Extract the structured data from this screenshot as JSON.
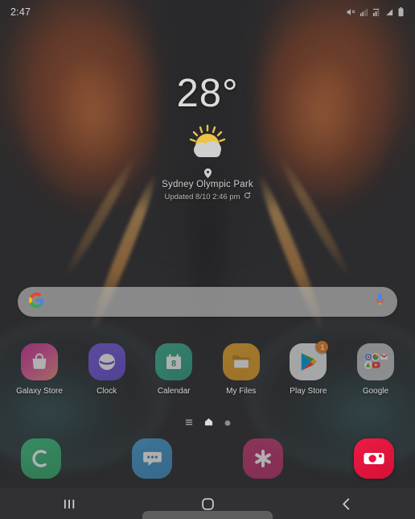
{
  "status_bar": {
    "time": "2:47",
    "icons": [
      "mute-icon",
      "signal-bars-icon",
      "signal-bars-alt-icon",
      "wifi-signal-icon",
      "battery-icon"
    ]
  },
  "weather_widget": {
    "temperature": "28°",
    "condition_icon": "partly-cloudy-icon",
    "location": "Sydney Olympic Park",
    "updated": "Updated 8/10 2:46 pm",
    "refresh_icon": "refresh-icon",
    "location_pin_icon": "location-pin-icon"
  },
  "search": {
    "google_icon": "google-g-icon",
    "mic_icon": "microphone-icon",
    "placeholder": ""
  },
  "apps": [
    {
      "label": "Galaxy Store",
      "icon": "galaxy-store-icon",
      "badge": ""
    },
    {
      "label": "Clock",
      "icon": "clock-icon",
      "badge": ""
    },
    {
      "label": "Calendar",
      "icon": "calendar-icon",
      "badge": "",
      "day": "8"
    },
    {
      "label": "My Files",
      "icon": "my-files-icon",
      "badge": ""
    },
    {
      "label": "Play Store",
      "icon": "play-store-icon",
      "badge": "1"
    },
    {
      "label": "Google",
      "icon": "google-folder-icon",
      "badge": ""
    }
  ],
  "page_indicator": {
    "items": [
      "apps-list-icon",
      "home-page-icon",
      "page-dot-icon"
    ],
    "active_index": 1
  },
  "dock": [
    {
      "label": "Phone",
      "icon": "phone-icon"
    },
    {
      "label": "Messages",
      "icon": "messages-icon"
    },
    {
      "label": "Gallery",
      "icon": "gallery-icon"
    },
    {
      "label": "Camera",
      "icon": "camera-icon"
    }
  ],
  "navigation_bar": [
    {
      "label": "Recents",
      "icon": "recents-icon"
    },
    {
      "label": "Home",
      "icon": "home-icon"
    },
    {
      "label": "Back",
      "icon": "back-icon"
    }
  ],
  "colors": {
    "background": "#323234",
    "accent_orange": "#c56838",
    "camera_red": "#e8123c",
    "badge_orange": "#f58220",
    "nav_bar": "#313133"
  }
}
